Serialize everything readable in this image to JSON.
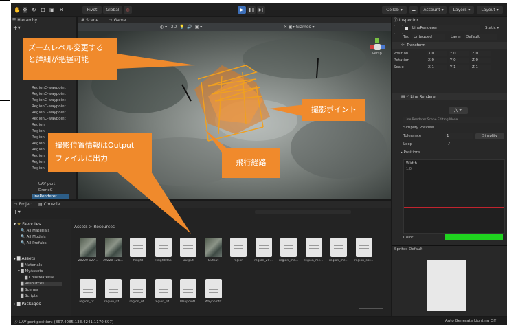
{
  "toolbar": {
    "pivot_label": "Pivot",
    "global_label": "Global",
    "collab_label": "Collab",
    "account_label": "Account",
    "layers_label": "Layers",
    "layout_label": "Layout"
  },
  "tabs": {
    "hierarchy": "Hierarchy",
    "scene": "Scene",
    "game": "Game",
    "inspector": "Inspector",
    "project": "Project",
    "console": "Console"
  },
  "scene": {
    "zoom_text": "2D",
    "gizmos_label": "Gizmos",
    "persp_label": "Persp"
  },
  "hierarchy": {
    "items": [
      {
        "label": "RegionC-waypoint"
      },
      {
        "label": "RegionC-waypoint"
      },
      {
        "label": "RegionC-waypoint"
      },
      {
        "label": "RegionC-waypoint"
      },
      {
        "label": "RegionC-waypoint"
      },
      {
        "label": "RegionC-waypoint"
      },
      {
        "label": "Region"
      },
      {
        "label": "Region"
      },
      {
        "label": "Region"
      },
      {
        "label": "Region"
      },
      {
        "label": "Region"
      },
      {
        "label": "Region"
      },
      {
        "label": "Region"
      },
      {
        "label": "Region"
      },
      {
        "label": "UAV port"
      },
      {
        "label": "DroneC"
      },
      {
        "label": "LineRenderer"
      }
    ]
  },
  "callouts": {
    "zoom": "ズームレベル変更する\nと詳細が把握可能",
    "shooting_point": "撮影ポイント",
    "flight_path": "飛行経路",
    "output": "撮影位置情報はOutput\nファイルに出力"
  },
  "inspector": {
    "object_name": "LineRenderer",
    "static_label": "Static",
    "tag_label": "Tag",
    "tag_value": "Untagged",
    "layer_label": "Layer",
    "layer_value": "Default",
    "transform_title": "Transform",
    "position_label": "Position",
    "rotation_label": "Rotation",
    "scale_label": "Scale",
    "position": [
      "0",
      "0",
      "0"
    ],
    "rotation": [
      "0",
      "0",
      "0"
    ],
    "scale": [
      "1",
      "1",
      "1"
    ],
    "line_renderer_title": "Line Renderer",
    "editing_mode": "Line Renderer Scene Editing Mode",
    "simplify_preview": "Simplify Preview",
    "tolerance_label": "Tolerance",
    "tolerance_value": "1",
    "simplify_button": "Simplify",
    "loop_label": "Loop",
    "positions_label": "Positions",
    "width_label": "Width",
    "width_value": "1.0",
    "color_label": "Color",
    "color_value": "#1fd31f",
    "sprites_label": "Sprites-Default"
  },
  "project": {
    "favorites_label": "Favorites",
    "favorites": [
      "All Materials",
      "All Models",
      "All Prefabs"
    ],
    "assets_label": "Assets",
    "assets_children": [
      "Materials",
      "MyAssets",
      "ColorMaterial",
      "Resources",
      "Scenes",
      "Scripts"
    ],
    "packages_label": "Packages",
    "breadcrumb": "Assets > Resources",
    "row1": [
      {
        "label": "20220-127...",
        "kind": "image"
      },
      {
        "label": "20220-128...",
        "kind": "image"
      },
      {
        "label": "height",
        "kind": "doc"
      },
      {
        "label": "HeightMap",
        "kind": "doc"
      },
      {
        "label": "Output",
        "kind": "doc"
      },
      {
        "label": "Output",
        "kind": "image"
      },
      {
        "label": "region",
        "kind": "doc"
      },
      {
        "label": "region_20...",
        "kind": "doc"
      },
      {
        "label": "region_me...",
        "kind": "doc"
      },
      {
        "label": "region_me...",
        "kind": "doc"
      },
      {
        "label": "region_me...",
        "kind": "doc"
      },
      {
        "label": "region_sor...",
        "kind": "doc"
      }
    ],
    "row2": [
      {
        "label": "region_rif...",
        "kind": "doc"
      },
      {
        "label": "region_rif...",
        "kind": "doc"
      },
      {
        "label": "region_rif...",
        "kind": "doc"
      },
      {
        "label": "region_rif...",
        "kind": "doc"
      },
      {
        "label": "WaypointO",
        "kind": "doc"
      },
      {
        "label": "WaypointC",
        "kind": "doc"
      }
    ]
  },
  "status": {
    "left": "UAV port position: (867.4085,133.4241,1170.697)",
    "right": "Auto Generate Lighting Off"
  }
}
